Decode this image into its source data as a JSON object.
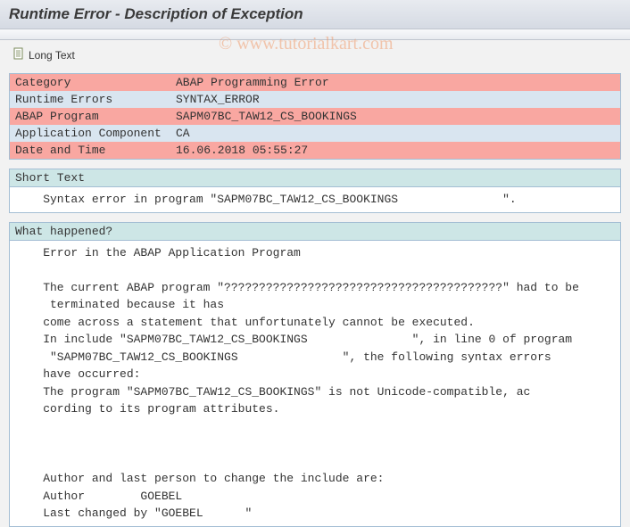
{
  "watermark": "© www.tutorialkart.com",
  "header": {
    "title": "Runtime Error - Description of Exception"
  },
  "toolbar": {
    "long_text_label": "Long Text"
  },
  "info": {
    "rows": [
      {
        "style": "red",
        "label": "Category",
        "value": "ABAP Programming Error"
      },
      {
        "style": "gray",
        "label": "Runtime Errors",
        "value": "SYNTAX_ERROR"
      },
      {
        "style": "red",
        "label": "ABAP Program",
        "value": "SAPM07BC_TAW12_CS_BOOKINGS"
      },
      {
        "style": "gray",
        "label": "Application Component",
        "value": "CA"
      },
      {
        "style": "red",
        "label": "Date and Time",
        "value": "16.06.2018 05:55:27"
      }
    ]
  },
  "short_text": {
    "header": "Short Text",
    "body": "    Syntax error in program \"SAPM07BC_TAW12_CS_BOOKINGS               \"."
  },
  "what_happened": {
    "header": "What happened?",
    "body": "    Error in the ABAP Application Program\n\n    The current ABAP program \"????????????????????????????????????????\" had to be\n     terminated because it has\n    come across a statement that unfortunately cannot be executed.\n    In include \"SAPM07BC_TAW12_CS_BOOKINGS               \", in line 0 of program\n     \"SAPM07BC_TAW12_CS_BOOKINGS               \", the following syntax errors\n    have occurred:\n    The program \"SAPM07BC_TAW12_CS_BOOKINGS\" is not Unicode-compatible, ac\n    cording to its program attributes.\n\n\n\n    Author and last person to change the include are:\n    Author        GOEBEL\n    Last changed by \"GOEBEL      \""
  }
}
